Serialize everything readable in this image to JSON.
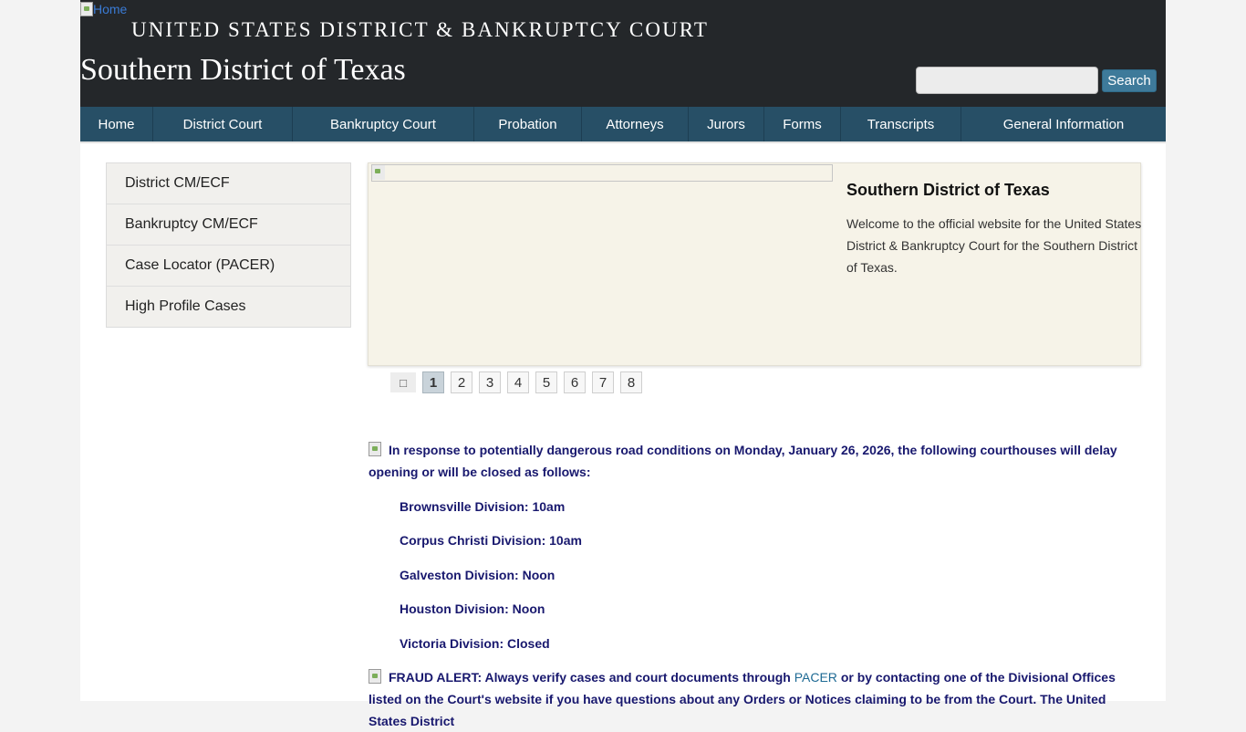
{
  "header": {
    "home_alt": "Home",
    "court_name": "UNITED STATES DISTRICT & BANKRUPTCY COURT",
    "district_name": "Southern District of Texas",
    "search_value": "",
    "search_button": "Search"
  },
  "nav": {
    "items": [
      {
        "label": "Home"
      },
      {
        "label": "District Court"
      },
      {
        "label": "Bankruptcy Court"
      },
      {
        "label": "Probation"
      },
      {
        "label": "Attorneys"
      },
      {
        "label": "Jurors"
      },
      {
        "label": "Forms"
      },
      {
        "label": "Transcripts"
      },
      {
        "label": "General Information"
      }
    ]
  },
  "sidebar": {
    "items": [
      {
        "label": "District CM/ECF"
      },
      {
        "label": "Bankruptcy CM/ECF"
      },
      {
        "label": "Case Locator (PACER)"
      },
      {
        "label": "High Profile Cases"
      }
    ]
  },
  "slider": {
    "title": "Southern District of Texas",
    "text": "Welcome to the official website for the United States District & Bankruptcy Court for the Southern District of Texas."
  },
  "pager": {
    "prev_icon": "chevron-left-icon",
    "pages": [
      "1",
      "2",
      "3",
      "4",
      "5",
      "6",
      "7",
      "8"
    ],
    "active": "1"
  },
  "notices": {
    "weather": "In response to potentially dangerous road conditions on Monday, January 26, 2026, the following courthouses will delay opening or will be closed as follows:",
    "divisions": [
      "Brownsville Division: 10am",
      "Corpus Christi Division: 10am",
      "Galveston Division: Noon",
      "Houston Division: Noon",
      "Victoria Division: Closed"
    ],
    "fraud_prefix": "FRAUD ALERT: Always verify cases and court documents through",
    "fraud_link": "PACER",
    "fraud_suffix": "or by contacting one of the Divisional Offices listed on the Court's website if you have questions about any Orders or Notices claiming to be from the Court. The United States District"
  },
  "colors": {
    "header_bg": "#24272a",
    "nav_bg": "#274f66",
    "search_button_bg": "#3e7a9a",
    "notice_text": "#18186e",
    "slider_bg": "#f6f3e8"
  }
}
